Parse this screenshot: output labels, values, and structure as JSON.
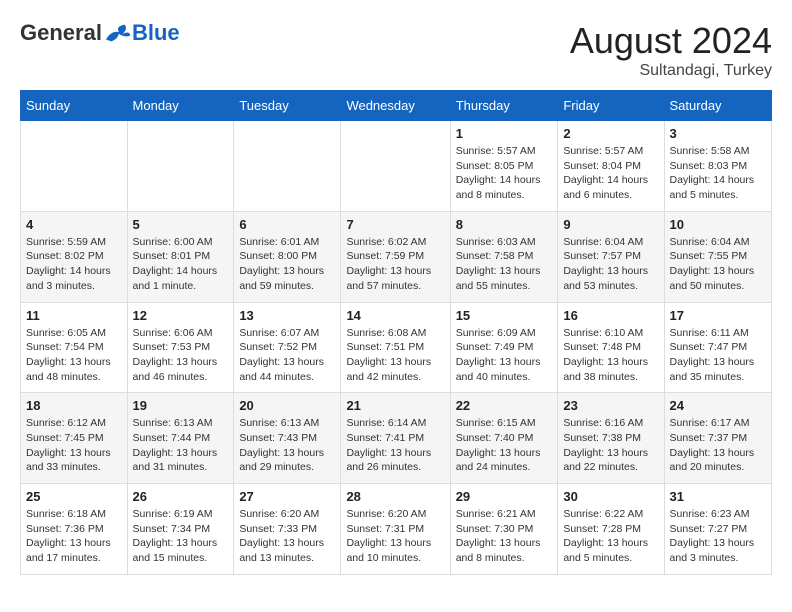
{
  "logo": {
    "general": "General",
    "blue": "Blue"
  },
  "header": {
    "month": "August 2024",
    "location": "Sultandagi, Turkey"
  },
  "weekdays": [
    "Sunday",
    "Monday",
    "Tuesday",
    "Wednesday",
    "Thursday",
    "Friday",
    "Saturday"
  ],
  "weeks": [
    [
      {
        "day": "",
        "info": ""
      },
      {
        "day": "",
        "info": ""
      },
      {
        "day": "",
        "info": ""
      },
      {
        "day": "",
        "info": ""
      },
      {
        "day": "1",
        "info": "Sunrise: 5:57 AM\nSunset: 8:05 PM\nDaylight: 14 hours\nand 8 minutes."
      },
      {
        "day": "2",
        "info": "Sunrise: 5:57 AM\nSunset: 8:04 PM\nDaylight: 14 hours\nand 6 minutes."
      },
      {
        "day": "3",
        "info": "Sunrise: 5:58 AM\nSunset: 8:03 PM\nDaylight: 14 hours\nand 5 minutes."
      }
    ],
    [
      {
        "day": "4",
        "info": "Sunrise: 5:59 AM\nSunset: 8:02 PM\nDaylight: 14 hours\nand 3 minutes."
      },
      {
        "day": "5",
        "info": "Sunrise: 6:00 AM\nSunset: 8:01 PM\nDaylight: 14 hours\nand 1 minute."
      },
      {
        "day": "6",
        "info": "Sunrise: 6:01 AM\nSunset: 8:00 PM\nDaylight: 13 hours\nand 59 minutes."
      },
      {
        "day": "7",
        "info": "Sunrise: 6:02 AM\nSunset: 7:59 PM\nDaylight: 13 hours\nand 57 minutes."
      },
      {
        "day": "8",
        "info": "Sunrise: 6:03 AM\nSunset: 7:58 PM\nDaylight: 13 hours\nand 55 minutes."
      },
      {
        "day": "9",
        "info": "Sunrise: 6:04 AM\nSunset: 7:57 PM\nDaylight: 13 hours\nand 53 minutes."
      },
      {
        "day": "10",
        "info": "Sunrise: 6:04 AM\nSunset: 7:55 PM\nDaylight: 13 hours\nand 50 minutes."
      }
    ],
    [
      {
        "day": "11",
        "info": "Sunrise: 6:05 AM\nSunset: 7:54 PM\nDaylight: 13 hours\nand 48 minutes."
      },
      {
        "day": "12",
        "info": "Sunrise: 6:06 AM\nSunset: 7:53 PM\nDaylight: 13 hours\nand 46 minutes."
      },
      {
        "day": "13",
        "info": "Sunrise: 6:07 AM\nSunset: 7:52 PM\nDaylight: 13 hours\nand 44 minutes."
      },
      {
        "day": "14",
        "info": "Sunrise: 6:08 AM\nSunset: 7:51 PM\nDaylight: 13 hours\nand 42 minutes."
      },
      {
        "day": "15",
        "info": "Sunrise: 6:09 AM\nSunset: 7:49 PM\nDaylight: 13 hours\nand 40 minutes."
      },
      {
        "day": "16",
        "info": "Sunrise: 6:10 AM\nSunset: 7:48 PM\nDaylight: 13 hours\nand 38 minutes."
      },
      {
        "day": "17",
        "info": "Sunrise: 6:11 AM\nSunset: 7:47 PM\nDaylight: 13 hours\nand 35 minutes."
      }
    ],
    [
      {
        "day": "18",
        "info": "Sunrise: 6:12 AM\nSunset: 7:45 PM\nDaylight: 13 hours\nand 33 minutes."
      },
      {
        "day": "19",
        "info": "Sunrise: 6:13 AM\nSunset: 7:44 PM\nDaylight: 13 hours\nand 31 minutes."
      },
      {
        "day": "20",
        "info": "Sunrise: 6:13 AM\nSunset: 7:43 PM\nDaylight: 13 hours\nand 29 minutes."
      },
      {
        "day": "21",
        "info": "Sunrise: 6:14 AM\nSunset: 7:41 PM\nDaylight: 13 hours\nand 26 minutes."
      },
      {
        "day": "22",
        "info": "Sunrise: 6:15 AM\nSunset: 7:40 PM\nDaylight: 13 hours\nand 24 minutes."
      },
      {
        "day": "23",
        "info": "Sunrise: 6:16 AM\nSunset: 7:38 PM\nDaylight: 13 hours\nand 22 minutes."
      },
      {
        "day": "24",
        "info": "Sunrise: 6:17 AM\nSunset: 7:37 PM\nDaylight: 13 hours\nand 20 minutes."
      }
    ],
    [
      {
        "day": "25",
        "info": "Sunrise: 6:18 AM\nSunset: 7:36 PM\nDaylight: 13 hours\nand 17 minutes."
      },
      {
        "day": "26",
        "info": "Sunrise: 6:19 AM\nSunset: 7:34 PM\nDaylight: 13 hours\nand 15 minutes."
      },
      {
        "day": "27",
        "info": "Sunrise: 6:20 AM\nSunset: 7:33 PM\nDaylight: 13 hours\nand 13 minutes."
      },
      {
        "day": "28",
        "info": "Sunrise: 6:20 AM\nSunset: 7:31 PM\nDaylight: 13 hours\nand 10 minutes."
      },
      {
        "day": "29",
        "info": "Sunrise: 6:21 AM\nSunset: 7:30 PM\nDaylight: 13 hours\nand 8 minutes."
      },
      {
        "day": "30",
        "info": "Sunrise: 6:22 AM\nSunset: 7:28 PM\nDaylight: 13 hours\nand 5 minutes."
      },
      {
        "day": "31",
        "info": "Sunrise: 6:23 AM\nSunset: 7:27 PM\nDaylight: 13 hours\nand 3 minutes."
      }
    ]
  ]
}
